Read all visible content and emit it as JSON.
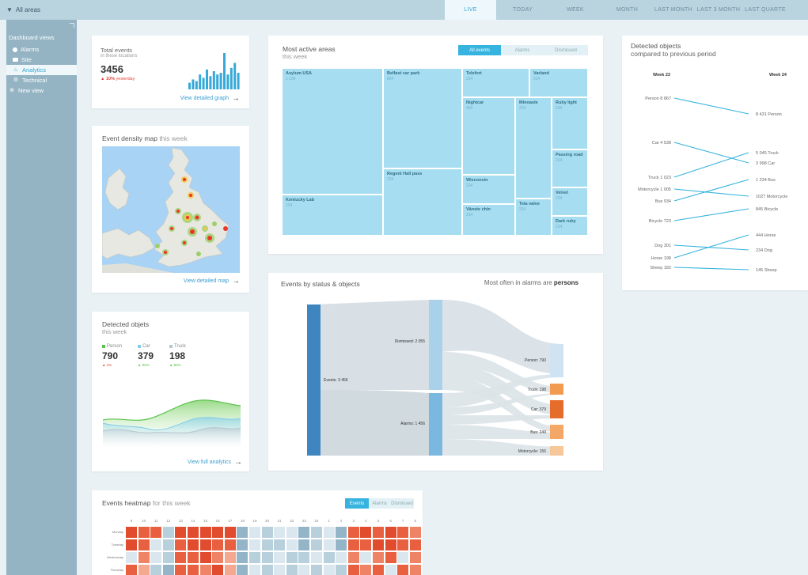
{
  "topbar": {
    "area_label": "All areas",
    "ranges": [
      "LIVE",
      "TODAY",
      "WEEK",
      "MONTH",
      "LAST MONTH",
      "LAST 3 MONTH",
      "LAST QUARTE"
    ]
  },
  "sidebar": {
    "title": "Dashboard views",
    "items": [
      {
        "label": "Alarms",
        "icon": "alarm-dot-icon"
      },
      {
        "label": "Site",
        "icon": "folder-icon"
      },
      {
        "label": "Analytics",
        "icon": "analytics-icon"
      },
      {
        "label": "Technical",
        "icon": "gear-icon"
      },
      {
        "label": "New view",
        "icon": "plus-icon"
      }
    ],
    "active_index": 2
  },
  "total_events": {
    "title": "Total events",
    "subtitle": "in these locations",
    "value": "3456",
    "change": "▲ 10%",
    "change_label": "yesterday",
    "bars": [
      4,
      6,
      5,
      9,
      7,
      12,
      8,
      11,
      9,
      10,
      22,
      9,
      13,
      16,
      10
    ],
    "link": "View detailed graph"
  },
  "density_map": {
    "title": "Event density map",
    "title_suffix": "this week",
    "link": "View detailed map"
  },
  "detected_objects_small": {
    "title": "Detected objets",
    "subtitle": "this week",
    "items": [
      {
        "label": "Person",
        "value": "790",
        "change": "▲ 4%",
        "color": "#5cc34e",
        "change_color": "#e0453a"
      },
      {
        "label": "Car",
        "value": "379",
        "change": "▲ 96%",
        "color": "#7fcde6",
        "change_color": "#5cc34e"
      },
      {
        "label": "Truck",
        "value": "198",
        "change": "▲ 89%",
        "color": "#b5c6cf",
        "change_color": "#5cc34e"
      }
    ],
    "link": "View full analytics"
  },
  "active_areas": {
    "title": "Most active areas",
    "subtitle": "this week",
    "toggles": [
      "All events",
      "Alarms",
      "Dismissed"
    ],
    "active_toggle": 0,
    "tiles": [
      {
        "name": "Asylum USA",
        "value": "1 234"
      },
      {
        "name": "Belfast car park",
        "value": "884"
      },
      {
        "name": "Telefort",
        "value": "234"
      },
      {
        "name": "Varland",
        "value": "234"
      },
      {
        "name": "Nightcar",
        "value": "456"
      },
      {
        "name": "Minoaste",
        "value": "234"
      },
      {
        "name": "Ruby light",
        "value": "234"
      },
      {
        "name": "Passing road",
        "value": "234"
      },
      {
        "name": "Regent Hall pass",
        "value": "234"
      },
      {
        "name": "Wisconsin",
        "value": "234"
      },
      {
        "name": "Velvet",
        "value": "234"
      },
      {
        "name": "Kentucky Lab",
        "value": "234"
      },
      {
        "name": "Tela valve",
        "value": "234"
      },
      {
        "name": "Vänste chin",
        "value": "234"
      },
      {
        "name": "Dark ruby",
        "value": "234"
      }
    ]
  },
  "sankey": {
    "title": "Events by status & objects",
    "note_prefix": "Most often in alarms are",
    "note_bold": "persons",
    "source": "Events: 3 456",
    "mid": [
      "Dismissed: 2 055",
      "Alarms: 1 456"
    ],
    "targets": [
      "Person: 790",
      "Truck: 198",
      "Car: 379",
      "Bus: 249",
      "Motorcycle: 156"
    ],
    "colors": {
      "source": "#3f86c0",
      "mid": "#a9d2ea",
      "person": "#cfe3f2",
      "truck": "#f29a50",
      "car": "#e66c2c",
      "bus": "#f4a766",
      "motorcycle": "#f7c79a"
    }
  },
  "compare": {
    "title": "Detected objects",
    "subtitle": "compared to previous period",
    "left_header": "Week 23",
    "right_header": "Week 24",
    "left": [
      {
        "label": "Person",
        "value": "8 867"
      },
      {
        "label": "Car",
        "value": "4 538"
      },
      {
        "label": "Truck",
        "value": "1 023"
      },
      {
        "label": "Motorcycle",
        "value": "1 005"
      },
      {
        "label": "Bus",
        "value": "934"
      },
      {
        "label": "Bicycle",
        "value": "723"
      },
      {
        "label": "Dog",
        "value": "301"
      },
      {
        "label": "Horse",
        "value": "198"
      },
      {
        "label": "Sheep",
        "value": "182"
      }
    ],
    "right": [
      {
        "label": "Person",
        "value": "8 431"
      },
      {
        "label": "Truck",
        "value": "5 045"
      },
      {
        "label": "Car",
        "value": "3 998"
      },
      {
        "label": "Bus",
        "value": "1 234"
      },
      {
        "label": "Motorcycle",
        "value": "1027"
      },
      {
        "label": "Bicycle",
        "value": "845"
      },
      {
        "label": "Horse",
        "value": "444"
      },
      {
        "label": "Dog",
        "value": "234"
      },
      {
        "label": "Sheep",
        "value": "145"
      }
    ]
  },
  "heatmap": {
    "title": "Events heatmap",
    "title_suffix": "for this week",
    "toggles": [
      "Events",
      "Alarms",
      "Dismissed"
    ],
    "active_toggle": 0,
    "hours": [
      "9",
      "10",
      "11",
      "12",
      "13",
      "14",
      "15",
      "16",
      "17",
      "18",
      "19",
      "20",
      "21",
      "22",
      "23",
      "24",
      "1",
      "2",
      "3",
      "4",
      "5",
      "6",
      "7",
      "8"
    ],
    "rows": [
      "Monday",
      "Tuesday",
      "Wednesday",
      "Thursday"
    ],
    "values": [
      [
        5,
        4,
        4,
        -2,
        5,
        5,
        5,
        5,
        5,
        -3,
        -1,
        -2,
        -1,
        -1,
        -3,
        -2,
        -1,
        -3,
        4,
        5,
        4,
        5,
        4,
        3
      ],
      [
        5,
        4,
        -1,
        -2,
        4,
        5,
        5,
        4,
        4,
        -3,
        -1,
        -2,
        -2,
        -1,
        -3,
        -2,
        -1,
        -3,
        4,
        4,
        5,
        5,
        4,
        4
      ],
      [
        -1,
        3,
        -1,
        -2,
        4,
        4,
        5,
        3,
        2,
        -3,
        -2,
        -2,
        -1,
        -2,
        -2,
        -1,
        -2,
        -1,
        3,
        -1,
        3,
        4,
        -1,
        3
      ],
      [
        4,
        2,
        -2,
        -3,
        4,
        4,
        3,
        5,
        2,
        -3,
        -1,
        -2,
        -1,
        -2,
        -1,
        -2,
        -1,
        -2,
        4,
        3,
        4,
        -1,
        4,
        3
      ]
    ]
  }
}
